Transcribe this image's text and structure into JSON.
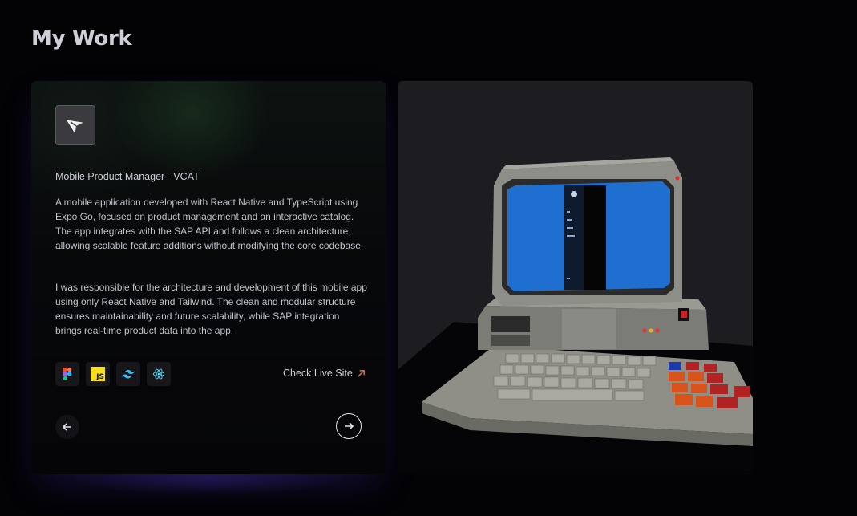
{
  "page": {
    "title": "My Work"
  },
  "project": {
    "logo_icon": "arrow-cursor-logo-icon",
    "title": "Mobile Product Manager - VCAT",
    "description_1": "A mobile application developed with React Native and TypeScript using Expo Go, focused on product management and an interactive catalog. The app integrates with the SAP API and follows a clean architecture, allowing scalable feature additions without modifying the core codebase.",
    "description_2": "I was responsible for the architecture and development of this mobile app using only React Native and Tailwind. The clean and modular structure ensures maintainability and future scalability, while SAP integration brings real-time product data into the app.",
    "tech_stack": [
      {
        "name": "figma",
        "icon": "figma-icon"
      },
      {
        "name": "javascript",
        "icon": "javascript-icon",
        "label": "JS"
      },
      {
        "name": "tailwind",
        "icon": "tailwind-icon"
      },
      {
        "name": "react",
        "icon": "react-icon"
      }
    ],
    "live_link_label": "Check Live Site",
    "live_link_icon": "arrow-up-right-icon"
  },
  "navigation": {
    "prev_icon": "arrow-left-icon",
    "next_icon": "arrow-right-icon"
  },
  "preview": {
    "type": "3d-retro-computer-render",
    "background_color": "#1d1d21"
  },
  "colors": {
    "background": "#030306",
    "accent_glow": "#4632aa",
    "link_arrow": "#e07a50"
  }
}
